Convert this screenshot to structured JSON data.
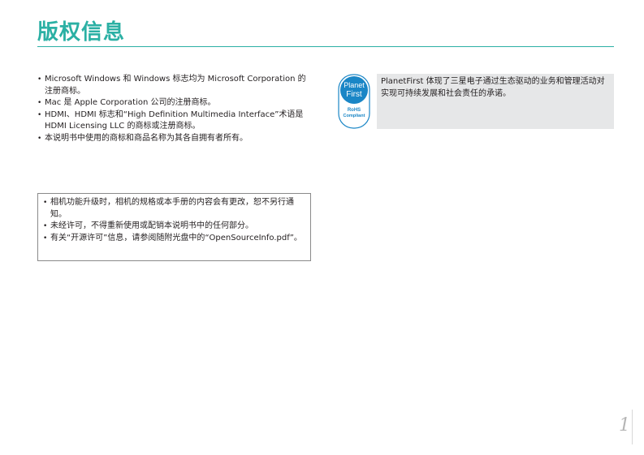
{
  "page": {
    "title": "版权信息",
    "page_number": "1"
  },
  "trademarks": [
    "Microsoft Windows 和 Windows 标志均为 Microsoft Corporation 的注册商标。",
    "Mac 是 Apple Corporation 公司的注册商标。",
    "HDMI、HDMI 标志和“High Definition Multimedia Interface”术语是 HDMI Licensing LLC 的商标或注册商标。",
    "本说明书中使用的商标和商品名称为其各自拥有者所有。"
  ],
  "notice": [
    "相机功能升级时，相机的规格或本手册的内容会有更改，恕不另行通知。",
    "未经许可，不得重新使用或配销本说明书中的任何部分。",
    "有关“开源许可”信息，请参阅随附光盘中的“OpenSourceInfo.pdf”。"
  ],
  "planetfirst": {
    "logo_line1": "Planet",
    "logo_line2": "First",
    "logo_line3": "RoHS",
    "logo_line4": "Compliant",
    "text": "PlanetFirst 体现了三星电子通过生态驱动的业务和管理活动对实现可持续发展和社会责任的承诺。",
    "logo_color": "#1a86c6"
  }
}
